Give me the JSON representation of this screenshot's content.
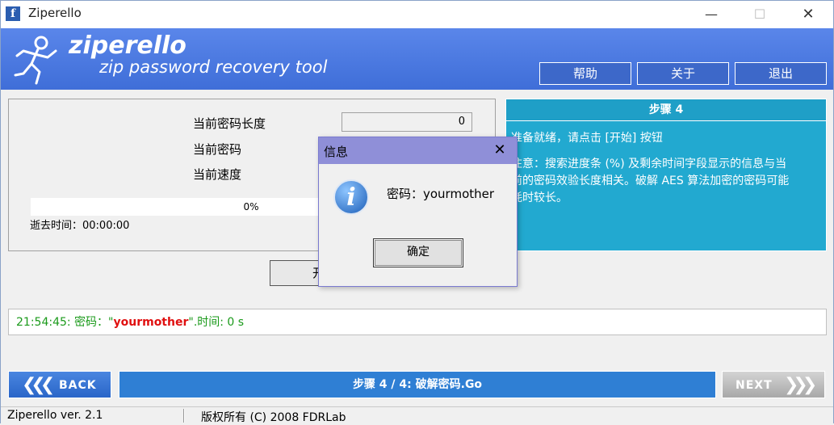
{
  "window": {
    "title": "Ziperello",
    "icon_letter": "f",
    "controls": {
      "minimize": "—",
      "maximize": "☐",
      "close": "✕"
    }
  },
  "header": {
    "logo_title": "ziperello",
    "logo_subtitle": "zip password recovery tool",
    "buttons": {
      "help": "帮助",
      "about": "关于",
      "exit": "退出"
    }
  },
  "status_panel": {
    "length_label": "当前密码长度",
    "length_value": "0",
    "password_label": "当前密码",
    "speed_label": "当前速度",
    "progress_fraction": 0,
    "progress_text": "0%",
    "elapsed_label": "逝去时间：00:00:00"
  },
  "start_button": {
    "label": "开始"
  },
  "info_panel": {
    "header": "步骤 4",
    "line1": "准备就绪，请点击 [开始] 按钮",
    "note_lines": [
      "注意：搜索进度条 (%) 及剩余时间字段显示的信息与当",
      "前的密码效验长度相关。破解 AES 算法加密的密码可能",
      "耗时较长。"
    ]
  },
  "log": {
    "time": "21:54:45:",
    "prefix": " 密码：\"",
    "password": "yourmother",
    "suffix": "\".时间: 0 s"
  },
  "nav": {
    "back": "BACK",
    "next": "NEXT",
    "step": "步骤 4 / 4: 破解密码.Go"
  },
  "statusbar": {
    "version": "Ziperello ver. 2.1",
    "copyright": "版权所有 (C) 2008 FDRLab"
  },
  "dialog": {
    "title": "信息",
    "close": "✕",
    "message": "密码：yourmother",
    "ok": "确定"
  },
  "colors": {
    "banner": "#4a79e2",
    "info_panel": "#22a9d0",
    "step_bar": "#2f7fd4",
    "log_text": "#1a9a1a",
    "log_password": "#e01010",
    "dialog_title": "#8f8fd8"
  }
}
